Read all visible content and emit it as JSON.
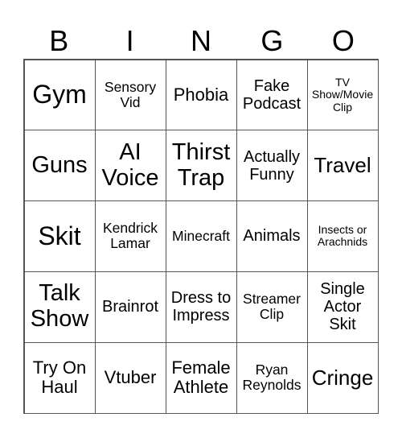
{
  "header": [
    "B",
    "I",
    "N",
    "G",
    "O"
  ],
  "cells": [
    [
      "Gym",
      "Sensory Vid",
      "Phobia",
      "Fake Podcast",
      "TV Show/Movie Clip"
    ],
    [
      "Guns",
      "AI Voice",
      "Thirst Trap",
      "Actually Funny",
      "Travel"
    ],
    [
      "Skit",
      "Kendrick Lamar",
      "Minecraft",
      "Animals",
      "Insects or Arachnids"
    ],
    [
      "Talk Show",
      "Brainrot",
      "Dress to Impress",
      "Streamer Clip",
      "Single Actor Skit"
    ],
    [
      "Try On Haul",
      "Vtuber",
      "Female Athlete",
      "Ryan Reynolds",
      "Cringe"
    ]
  ]
}
